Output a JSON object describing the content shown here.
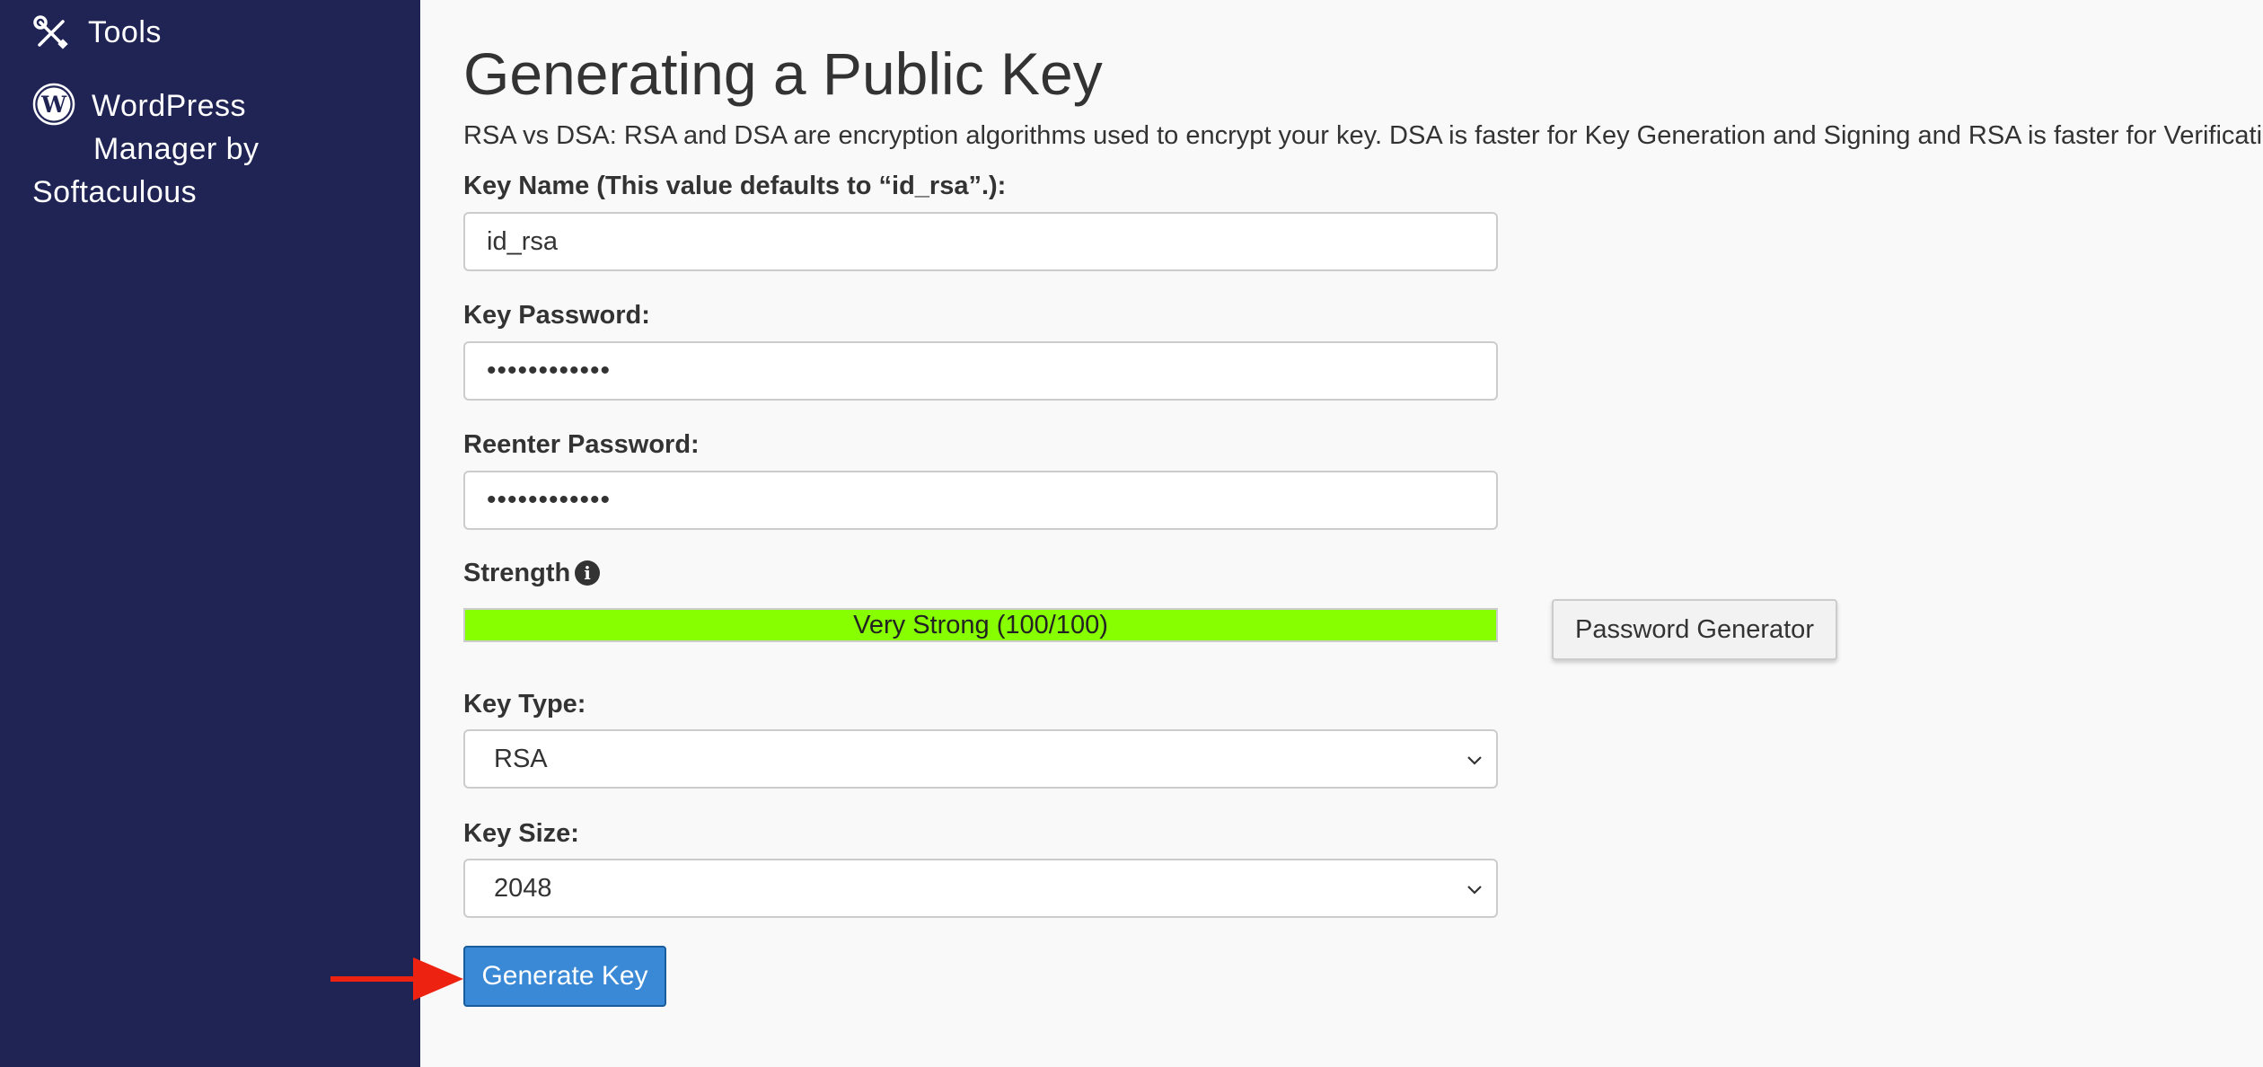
{
  "sidebar": {
    "items": [
      {
        "label": "Tools",
        "icon": "tools-icon"
      },
      {
        "label_lines": [
          "WordPress",
          "Manager by",
          "Softaculous"
        ],
        "icon": "wordpress-icon"
      }
    ],
    "background_color": "#1f2455"
  },
  "main": {
    "title": "Generating a Public Key",
    "description": "RSA vs DSA: RSA and DSA are encryption algorithms used to encrypt your key. DSA is faster for Key Generation and Signing and RSA is faster for Verification.",
    "key_name": {
      "label": "Key Name (This value defaults to “id_rsa”.):",
      "value": "id_rsa"
    },
    "key_password": {
      "label": "Key Password:",
      "value": "••••••••••••"
    },
    "reenter_password": {
      "label": "Reenter Password:",
      "value": "••••••••••••"
    },
    "strength": {
      "label": "Strength",
      "info_icon": "info-icon",
      "text": "Very Strong (100/100)",
      "score": 100,
      "max": 100,
      "color": "#88ff00"
    },
    "password_generator_label": "Password Generator",
    "key_type": {
      "label": "Key Type:",
      "selected": "RSA"
    },
    "key_size": {
      "label": "Key Size:",
      "selected": "2048"
    },
    "generate_button_label": "Generate Key",
    "generate_button_color": "#3a89d6",
    "annotation_arrow_color": "#ee2211"
  }
}
